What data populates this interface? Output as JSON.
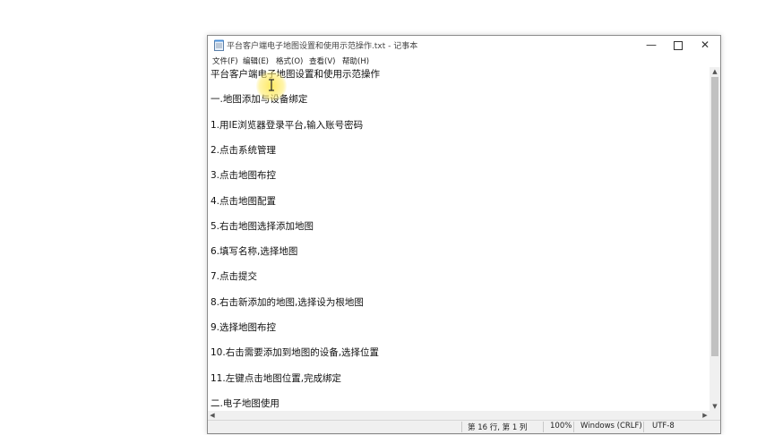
{
  "window": {
    "title": "平台客户端电子地图设置和使用示范操作.txt - 记事本",
    "minimize_icon": "minimize-icon",
    "maximize_icon": "maximize-icon",
    "close_icon": "close-icon"
  },
  "menu": {
    "items": [
      {
        "label": "文件(F)"
      },
      {
        "label": "编辑(E)"
      },
      {
        "label": "格式(O)"
      },
      {
        "label": "查看(V)"
      },
      {
        "label": "帮助(H)"
      }
    ]
  },
  "editor": {
    "lines": [
      "平台客户端电子地图设置和使用示范操作",
      "一.地图添加与设备绑定",
      "1.用IE浏览器登录平台,输入账号密码",
      "2.点击系统管理",
      "3.点击地图布控",
      "4.点击地图配置",
      "5.右击地图选择添加地图",
      "6.填写名称,选择地图",
      "7.点击提交",
      "8.右击新添加的地图,选择设为根地图",
      "9.选择地图布控",
      "10.右击需要添加到地图的设备,选择位置",
      "11.左键点击地图位置,完成绑定",
      "二.电子地图使用"
    ]
  },
  "status": {
    "position": "第 16 行, 第 1 列",
    "zoom": "100%",
    "line_ending": "Windows (CRLF)",
    "encoding": "UTF-8"
  },
  "colors": {
    "cursor_highlight": "#ffe646"
  }
}
